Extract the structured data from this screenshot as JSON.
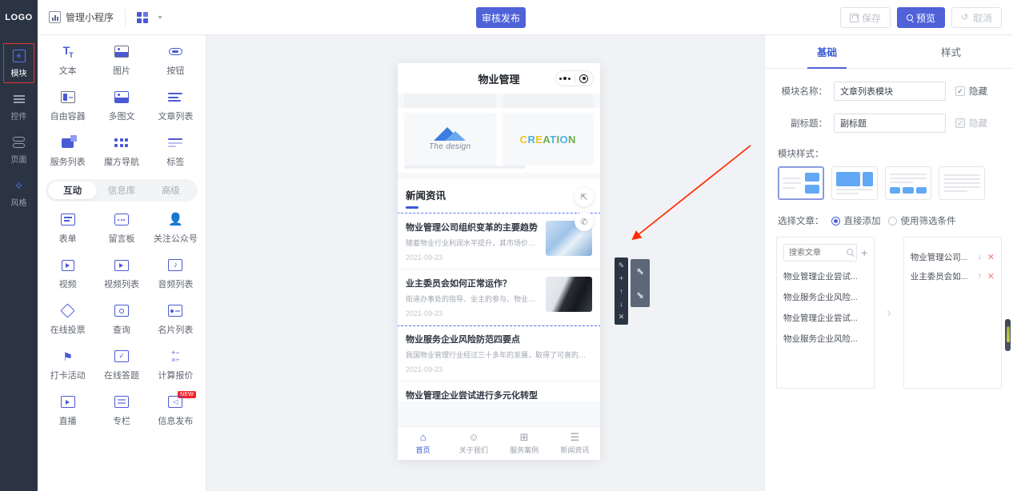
{
  "header": {
    "logo": "LOGO",
    "app_name": "管理小程序",
    "publish_label": "审核发布",
    "save_label": "保存",
    "preview_label": "预览",
    "cancel_label": "取消"
  },
  "rail": {
    "items": [
      {
        "label": "模块",
        "icon": "plus-square-icon",
        "active": true
      },
      {
        "label": "控件",
        "icon": "control-lines-icon",
        "active": false
      },
      {
        "label": "页面",
        "icon": "page-stack-icon",
        "active": false
      },
      {
        "label": "风格",
        "icon": "magic-wand-icon",
        "active": false
      }
    ]
  },
  "components": {
    "top_grid": [
      {
        "label": "文本",
        "icon": "text-icon"
      },
      {
        "label": "图片",
        "icon": "image-icon"
      },
      {
        "label": "按钮",
        "icon": "button-icon"
      },
      {
        "label": "自由容器",
        "icon": "container-icon"
      },
      {
        "label": "多图文",
        "icon": "multi-image-text-icon"
      },
      {
        "label": "文章列表",
        "icon": "article-list-icon"
      },
      {
        "label": "服务列表",
        "icon": "service-list-icon"
      },
      {
        "label": "魔方导航",
        "icon": "cube-nav-icon"
      },
      {
        "label": "标签",
        "icon": "tag-icon"
      }
    ],
    "tabs": [
      {
        "label": "互动",
        "active": true
      },
      {
        "label": "信息库",
        "active": false
      },
      {
        "label": "高级",
        "active": false
      }
    ],
    "bottom_grid": [
      {
        "label": "表单",
        "icon": "form-icon",
        "badge": ""
      },
      {
        "label": "留言板",
        "icon": "message-board-icon",
        "badge": ""
      },
      {
        "label": "关注公众号",
        "icon": "follow-account-icon",
        "badge": ""
      },
      {
        "label": "视频",
        "icon": "video-icon",
        "badge": ""
      },
      {
        "label": "视频列表",
        "icon": "video-list-icon",
        "badge": ""
      },
      {
        "label": "音频列表",
        "icon": "audio-list-icon",
        "badge": ""
      },
      {
        "label": "在线投票",
        "icon": "online-vote-icon",
        "badge": ""
      },
      {
        "label": "查询",
        "icon": "query-icon",
        "badge": ""
      },
      {
        "label": "名片列表",
        "icon": "card-list-icon",
        "badge": ""
      },
      {
        "label": "打卡活动",
        "icon": "checkin-activity-icon",
        "badge": ""
      },
      {
        "label": "在线答题",
        "icon": "online-quiz-icon",
        "badge": ""
      },
      {
        "label": "计算报价",
        "icon": "calculate-quote-icon",
        "badge": ""
      },
      {
        "label": "直播",
        "icon": "live-stream-icon",
        "badge": ""
      },
      {
        "label": "专栏",
        "icon": "column-icon",
        "badge": ""
      },
      {
        "label": "信息发布",
        "icon": "info-publish-icon",
        "badge": "NEW"
      }
    ]
  },
  "phone": {
    "title": "物业管理",
    "gallery": [
      {
        "caption": "The design",
        "kind": "design-logo"
      },
      {
        "caption": "CREATION",
        "kind": "creation-logo"
      }
    ],
    "news_section_title": "新闻资讯",
    "articles": [
      {
        "title": "物业管理公司组织变革的主要趋势",
        "desc": "随着物业行业利润水平提升，其市场价值逐...",
        "date": "2021-09-23"
      },
      {
        "title": "业主委员会如何正常运作？",
        "desc": "街道办事处的指导、业主的参与、物业服务...",
        "date": "2021-09-23"
      },
      {
        "title": "物业服务企业风险防范四要点",
        "desc": "我国物业管理行业经过三十多年的发展，取得了可喜的成绩，",
        "date": "2021-09-23"
      },
      {
        "title": "物业管理企业尝试进行多元化转型",
        "desc": "",
        "date": ""
      }
    ],
    "tabbar": [
      {
        "label": "首页",
        "icon": "home-icon",
        "active": true
      },
      {
        "label": "关于我们",
        "icon": "user-icon",
        "active": false
      },
      {
        "label": "服务案例",
        "icon": "grid-icon",
        "active": false
      },
      {
        "label": "新闻资讯",
        "icon": "news-icon",
        "active": false
      }
    ],
    "fabs": [
      {
        "icon": "share-icon"
      },
      {
        "icon": "phone-icon"
      }
    ]
  },
  "selection_toolbar": {
    "tools": [
      {
        "icon": "pencil-icon",
        "glyph": "✎"
      },
      {
        "icon": "plus-icon",
        "glyph": "+"
      },
      {
        "icon": "move-up-icon",
        "glyph": "↑"
      },
      {
        "icon": "move-down-icon",
        "glyph": "↓"
      },
      {
        "icon": "delete-icon",
        "glyph": "✕"
      }
    ],
    "panel": [
      {
        "icon": "arrow-up-left-icon",
        "glyph": "⬉"
      },
      {
        "icon": "arrow-down-right-icon",
        "glyph": "⬊"
      }
    ]
  },
  "props": {
    "tabs": [
      {
        "label": "基础",
        "active": true
      },
      {
        "label": "样式",
        "active": false
      }
    ],
    "module_name_label": "模块名称：",
    "module_name_value": "文章列表模块",
    "module_name_hide": "隐藏",
    "subtitle_label": "副标题：",
    "subtitle_value": "副标题",
    "subtitle_hide": "隐藏",
    "style_label": "模块样式：",
    "styles": [
      {
        "name": "list-right-thumb",
        "active": true
      },
      {
        "name": "big-image-split",
        "active": false
      },
      {
        "name": "three-column",
        "active": false
      },
      {
        "name": "text-only",
        "active": false
      }
    ],
    "choose_article_label": "选择文章：",
    "radios": [
      {
        "label": "直接添加",
        "selected": true
      },
      {
        "label": "使用筛选条件",
        "selected": false
      }
    ],
    "search_placeholder": "搜索文章",
    "available_articles": [
      "物业管理企业尝试...",
      "物业服务企业风险...",
      "物业管理企业尝试...",
      "物业服务企业风险..."
    ],
    "selected_articles": [
      {
        "name": "物业管理公司...",
        "move": "↓",
        "remove": "✕"
      },
      {
        "name": "业主委员会如...",
        "move": "↑",
        "remove": "✕"
      }
    ]
  },
  "colors": {
    "primary": "#4f62d8",
    "rail_bg": "#2b3443",
    "accent_red": "#e2352f",
    "canvas_bg": "#f0f2f5"
  }
}
